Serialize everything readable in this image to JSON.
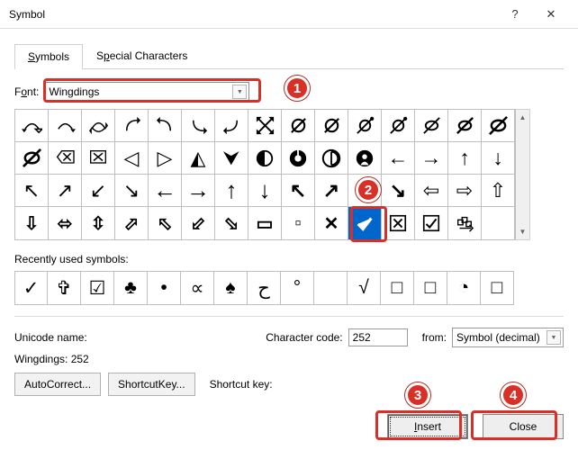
{
  "window": {
    "title": "Symbol"
  },
  "tabs": {
    "symbols": "Symbols",
    "special": "Special Characters"
  },
  "font": {
    "label_pre": "F",
    "label_ul": "o",
    "label_post": "nt:",
    "value": "Wingdings"
  },
  "recent_label": {
    "pre": "",
    "ul": "R",
    "post": "ecently used symbols:"
  },
  "recent": [
    "✓",
    "✞",
    "☑",
    "♣",
    "•",
    "∝",
    "♠",
    "ح",
    "°",
    " ",
    "√",
    "□",
    "□",
    "◔",
    "□"
  ],
  "unicode_name_label": "Unicode name:",
  "wingdings_code": "Wingdings: 252",
  "charcode": {
    "label_ul": "C",
    "label_post": "haracter code:",
    "value": "252"
  },
  "from": {
    "label_ul": "m",
    "label_pre": "fro",
    "label_post": ":",
    "value": "Symbol (decimal)"
  },
  "autocorrect": {
    "ul": "A",
    "post": "utoCorrect..."
  },
  "shortcut": {
    "label": "Shortcut ",
    "ul": "K",
    "post": "ey..."
  },
  "shortcut_key_label": "Shortcut key:",
  "insert": {
    "ul": "I",
    "post": "nsert"
  },
  "close": "Close",
  "badges": {
    "b1": "1",
    "b2": "2",
    "b3": "3",
    "b4": "4"
  }
}
